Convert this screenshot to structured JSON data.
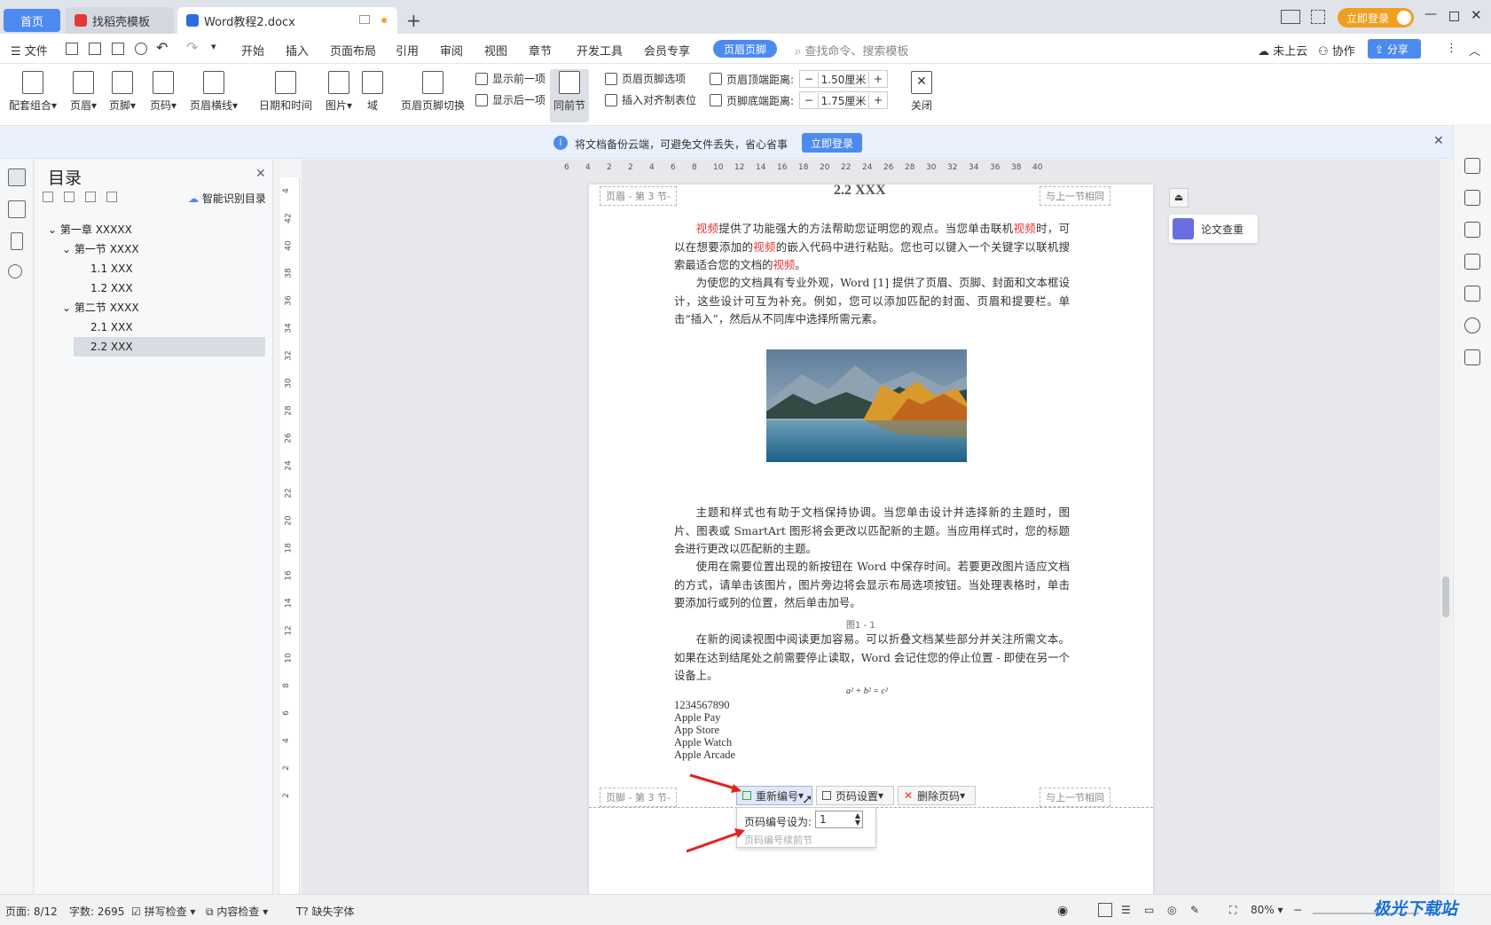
{
  "tabs": {
    "home": "首页",
    "template": "找稻壳模板",
    "doc": "Word教程2.docx"
  },
  "window": {
    "login_btn": "立即登录"
  },
  "menu": {
    "file": "文件",
    "items": [
      "开始",
      "插入",
      "页面布局",
      "引用",
      "审阅",
      "视图",
      "章节",
      "开发工具",
      "会员专享"
    ],
    "active": "页眉页脚",
    "search": "查找命令、搜索模板",
    "cloud": "未上云",
    "collab": "协作",
    "share": "分享"
  },
  "ribbon": {
    "combo": "配套组合",
    "header": "页眉",
    "footer": "页脚",
    "pagenum": "页码",
    "headerline": "页眉横线",
    "datetime": "日期和时间",
    "picture": "图片",
    "field": "域",
    "switch": "页眉页脚切换",
    "prev": "显示前一项",
    "next": "显示后一项",
    "same_prev": "同前节",
    "options": "页眉页脚选项",
    "insert_align": "插入对齐制表位",
    "top_dist_label": "页眉顶端距离:",
    "top_dist": "1.50厘米",
    "bottom_dist_label": "页脚底端距离:",
    "bottom_dist": "1.75厘米",
    "close": "关闭"
  },
  "notice": {
    "text": "将文档备份云端，可避免文件丢失，省心省事",
    "btn": "立即登录"
  },
  "toc": {
    "title": "目录",
    "smart": "智能识别目录",
    "items": [
      "第一章 XXXXX",
      "第一节 XXXX",
      "1.1 XXX",
      "1.2 XXX",
      "第二节 XXXX",
      "2.1 XXX",
      "2.2 XXX"
    ]
  },
  "ruler": {
    "h": [
      "6",
      "4",
      "2",
      "2",
      "4",
      "6",
      "8",
      "10",
      "12",
      "14",
      "16",
      "18",
      "20",
      "22",
      "24",
      "26",
      "28",
      "30",
      "32",
      "34",
      "36",
      "38",
      "40"
    ],
    "v": [
      "4",
      "42",
      "40",
      "38",
      "36",
      "34",
      "32",
      "30",
      "28",
      "26",
      "24",
      "22",
      "20",
      "18",
      "16",
      "14",
      "12",
      "10",
      "8",
      "6",
      "4",
      "2",
      "2"
    ]
  },
  "doc": {
    "header_tag": "页眉 - 第 3 节-",
    "same_as_prev": "与上一节相同",
    "heading": "2.2 XXX",
    "p1a": "视频",
    "p1b": "提供了功能强大的方法帮助您证明您的观点。当您单击联机",
    "p1c": "视频",
    "p1d": "时，可以在想要添加的",
    "p1e": "视频",
    "p1f": "的嵌入代码中进行粘贴。您也可以键入一个关键字以联机搜索最适合您的文档的",
    "p1g": "视频",
    "p1h": "。",
    "p2": "为使您的文档具有专业外观，Word [1] 提供了页眉、页脚、封面和文本框设计，这些设计可互为补充。例如，您可以添加匹配的封面、页眉和提要栏。单击“插入”，然后从不同库中选择所需元素。",
    "p3": "主题和样式也有助于文档保持协调。当您单击设计并选择新的主题时，图片、图表或 SmartArt 图形将会更改以匹配新的主题。当应用样式时，您的标题会进行更改以匹配新的主题。",
    "p4": "使用在需要位置出现的新按钮在 Word 中保存时间。若要更改图片适应文档的方式，请单击该图片，图片旁边将会显示布局选项按钮。当处理表格时，单击要添加行或列的位置，然后单击加号。",
    "caption": "图1 - 1",
    "p5": "在新的阅读视图中阅读更加容易。可以折叠文档某些部分并关注所需文本。如果在达到结尾处之前需要停止读取，Word 会记住您的停止位置 - 即使在另一个设备上。",
    "formula": "a² + b² = c²",
    "lines": [
      "1234567890",
      "Apple Pay",
      "App Store",
      "Apple Watch",
      "Apple Arcade"
    ],
    "footer_tag": "页脚 - 第 3 节-"
  },
  "footer_tools": {
    "renumber": "重新编号",
    "pageset": "页码设置",
    "delete": "删除页码",
    "set_label": "页码编号设为:",
    "set_value": "1",
    "continue": "页码编号续前节"
  },
  "side": {
    "thesis": "论文查重"
  },
  "status": {
    "page": "页面: 8/12",
    "words": "字数: 2695",
    "spell": "拼写检查",
    "content": "内容检查",
    "font": "缺失字体",
    "zoom": "80%"
  },
  "watermark": "极光下载站"
}
